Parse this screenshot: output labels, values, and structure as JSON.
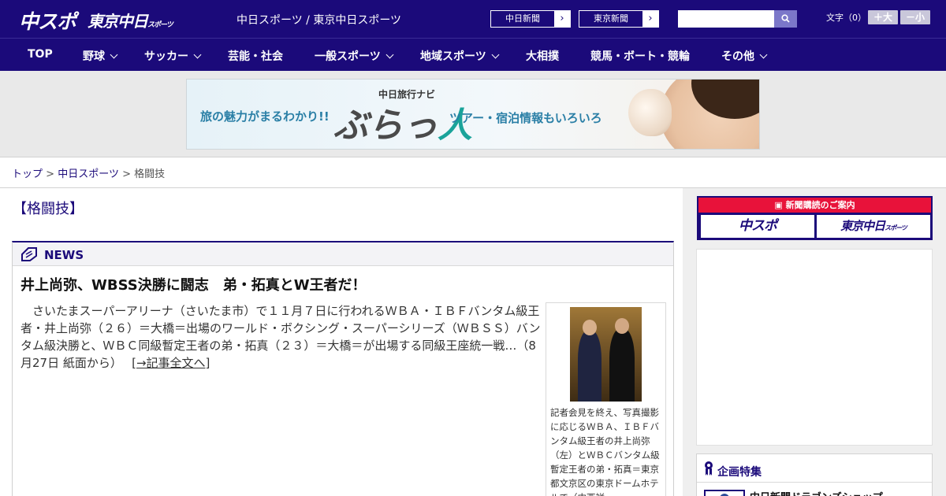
{
  "header": {
    "logo_chuspo": "中スポ",
    "logo_tokyo": "東京中日",
    "logo_tokyo_sub": "スポーツ",
    "site_links": "中日スポーツ / 東京中日スポーツ",
    "paper_buttons": [
      {
        "label": "中日新聞",
        "arrow": "›"
      },
      {
        "label": "東京新聞",
        "arrow": "›"
      }
    ],
    "search": {
      "value": "",
      "placeholder": ""
    },
    "font_size_label": "文字（0）",
    "font_bigger": "＋大",
    "font_smaller": "－小"
  },
  "nav": {
    "items": [
      {
        "label": "TOP",
        "has_menu": false
      },
      {
        "label": "野球",
        "has_menu": true
      },
      {
        "label": "サッカー",
        "has_menu": true
      },
      {
        "label": "芸能・社会",
        "has_menu": false
      },
      {
        "label": "一般スポーツ",
        "has_menu": true
      },
      {
        "label": "地域スポーツ",
        "has_menu": true
      },
      {
        "label": "大相撲",
        "has_menu": false
      },
      {
        "label": "競馬・ボート・競輪",
        "has_menu": false
      },
      {
        "label": "その他",
        "has_menu": true
      }
    ]
  },
  "banner": {
    "left_text": "旅の魅力がまるわかり!!",
    "small_title": "中日旅行ナビ",
    "logo_text": "ぶらっ",
    "logo_accent": "人",
    "right_text": "ツアー・宿泊情報もいろいろ"
  },
  "breadcrumb": {
    "items": [
      "トップ",
      "中日スポーツ"
    ],
    "current": "格闘技",
    "separator": ">"
  },
  "page_title": "【格闘技】",
  "news": {
    "section_label": "NEWS",
    "headline": "井上尚弥、WBSS決勝に闘志　弟・拓真とW王者だ！",
    "body": "　さいたまスーパーアリーナ（さいたま市）で１１月７日に行われるＷＢＡ・ＩＢＦバンタム級王者・井上尚弥（２６）＝大橋＝出場のワールド・ボクシング・スーパーシリーズ（ＷＢＳＳ）バンタム級決勝と、ＷＢＣ同級暫定王者の弟・拓真（２３）＝大橋＝が出場する同級王座統一戦…（8月27日 紙面から）",
    "more_link": "[→記事全文へ]",
    "photo_caption": "記者会見を終え、写真撮影に応じるＷＢＡ、ＩＢＦバンタム級王者の井上尚弥（左）とＷＢＣバンタム級暫定王者の弟・拓真＝東京都文京区の東京ドームホテルで（中西祥"
  },
  "sidebar": {
    "subscription_head": "新聞購読のご案内",
    "sub_chuspo": "中スポ",
    "sub_tokyo": "東京中日",
    "sub_tokyo_small": "スポーツ",
    "feature_head": "企画特集",
    "feature_item": "中日新聞ドラゴンズショップ"
  },
  "colors": {
    "brand": "#1b0a7a",
    "accent_red": "#e8123a",
    "search_button": "#7b77c9"
  }
}
